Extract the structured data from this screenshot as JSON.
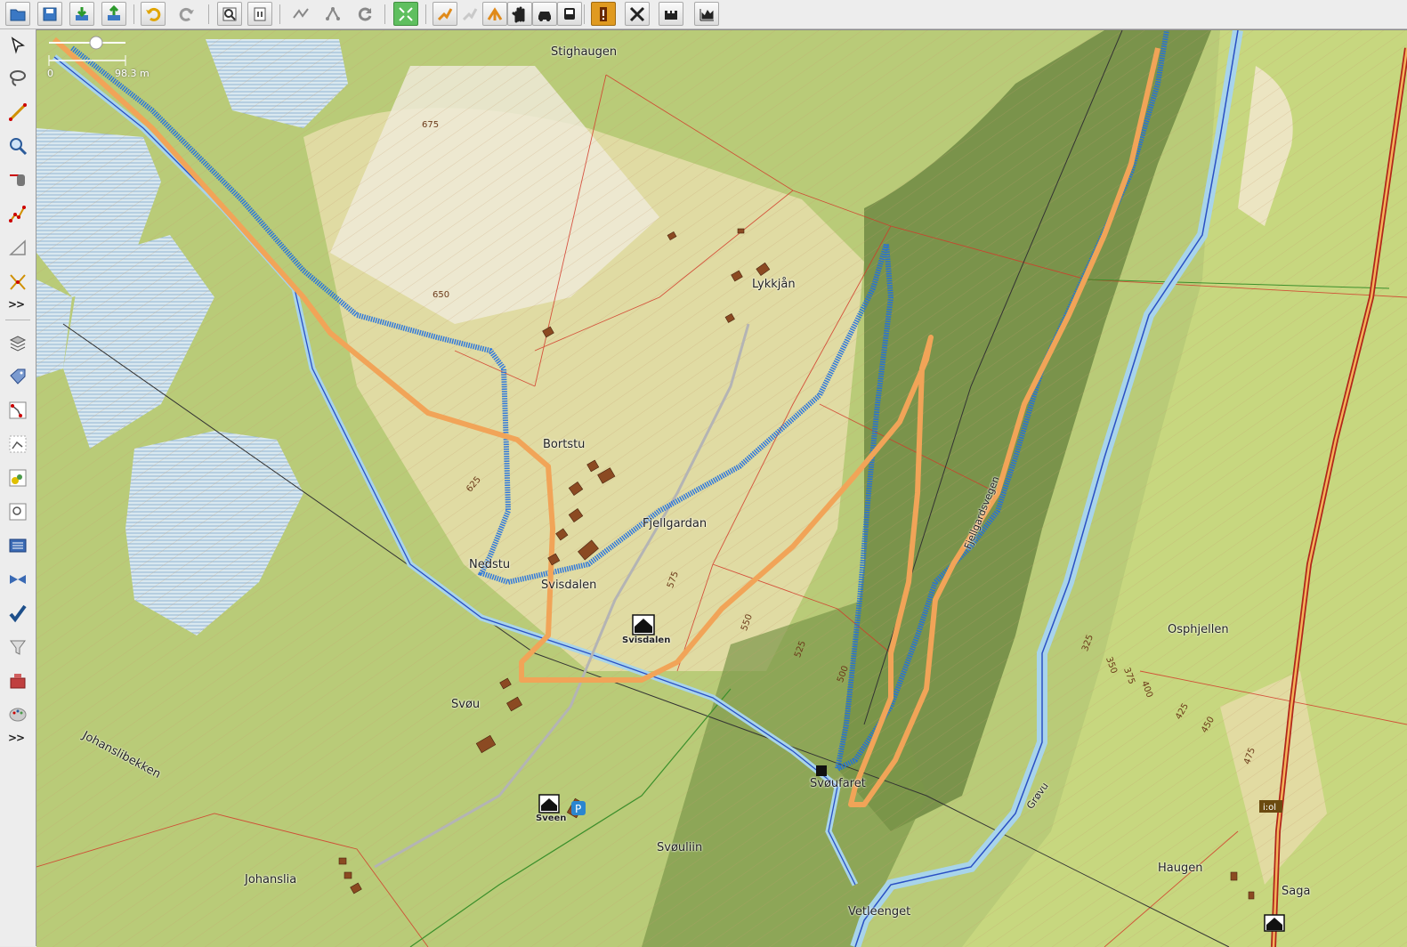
{
  "toolbar": {
    "buttons": [
      "open-icon",
      "save-icon",
      "download-icon",
      "upload-icon",
      "undo-icon",
      "redo-icon",
      "zoom-preferences-icon",
      "preferences-icon",
      "wireframe-icon",
      "relation-icon",
      "refresh-icon",
      "zoom-fit-icon",
      "route-foot-icon",
      "route-bicycle-icon",
      "route-split-icon",
      "hand-icon",
      "car-icon",
      "bus-icon",
      "warning-icon",
      "tools-icon",
      "layers-icon",
      "chart-icon"
    ]
  },
  "left_toolbar": {
    "more_label_1": ">>",
    "more_label_2": ">>",
    "buttons": [
      "select-icon",
      "lasso-icon",
      "draw-icon",
      "zoom-icon",
      "improve-way-icon",
      "parallel-icon",
      "measure-icon",
      "split-icon",
      "layers-icon",
      "tag-icon",
      "relation-icon",
      "selection-icon",
      "map-paint-icon",
      "filter-map-icon",
      "commandstack-icon",
      "conflict-icon",
      "validate-icon",
      "filter-icon",
      "plugin-icon",
      "palette-icon"
    ]
  },
  "map": {
    "scale": {
      "left": "0",
      "right": "98.3 m"
    },
    "place_labels": [
      {
        "text": "Stighaugen"
      },
      {
        "text": "Lykkjån"
      },
      {
        "text": "Bortstu"
      },
      {
        "text": "Fjellgardan"
      },
      {
        "text": "Nedstu"
      },
      {
        "text": "Svisdalen"
      },
      {
        "text": "Svøu"
      },
      {
        "text": "Johanslibekken"
      },
      {
        "text": "Johanslia"
      },
      {
        "text": "Svøuliin"
      },
      {
        "text": "Svøufaret"
      },
      {
        "text": "Vetleenget"
      },
      {
        "text": "Osphjellen"
      },
      {
        "text": "Haugen"
      },
      {
        "text": "Saga"
      },
      {
        "text": "Fjellgardsvegen"
      },
      {
        "text": "Grøvu"
      }
    ],
    "poi_labels": [
      "Svisdalen",
      "Sveen"
    ],
    "contour_labels": [
      "675",
      "650",
      "625",
      "575",
      "550",
      "525",
      "500",
      "325",
      "350",
      "375",
      "400",
      "425",
      "450",
      "475"
    ]
  }
}
